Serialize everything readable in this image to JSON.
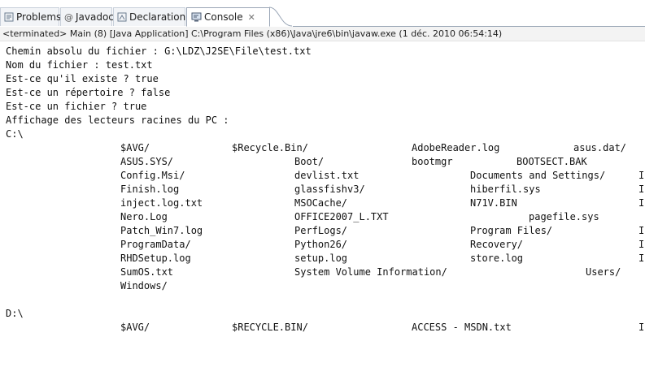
{
  "tabs": [
    {
      "label": "Problems",
      "icon": "problems-icon"
    },
    {
      "label": "Javadoc",
      "icon": "at-sign-icon"
    },
    {
      "label": "Declaration",
      "icon": "declaration-icon"
    },
    {
      "label": "Console",
      "icon": "console-icon",
      "active": true,
      "close": "✕"
    }
  ],
  "status_line": "<terminated> Main (8) [Java Application] C:\\Program Files (x86)\\Java\\jre6\\bin\\javaw.exe (1 déc. 2010 06:54:14)",
  "console": {
    "lines": [
      "Chemin absolu du fichier : G:\\LDZ\\J2SE\\File\\test.txt",
      "Nom du fichier : test.txt",
      "Est-ce qu'il existe ? true",
      "Est-ce un répertoire ? false",
      "Est-ce un fichier ? true",
      "Affichage des lecteurs racines du PC :",
      "C:\\"
    ],
    "c_entries": [
      [
        "$AVG/",
        "$Recycle.Bin/",
        "AdobeReader.log",
        "asus.dat/"
      ],
      [
        "ASUS.SYS/",
        "Boot/",
        "bootmgr",
        "BOOTSECT.BAK"
      ],
      [
        "Config.Msi/",
        "devlist.txt",
        "Documents and Settings/",
        "I"
      ],
      [
        "Finish.log",
        "glassfishv3/",
        "hiberfil.sys",
        "I"
      ],
      [
        "inject.log.txt",
        "MSOCache/",
        "N71V.BIN",
        "I"
      ],
      [
        "Nero.Log",
        "OFFICE2007_L.TXT",
        "pagefile.sys",
        ""
      ],
      [
        "Patch_Win7.log",
        "PerfLogs/",
        "Program Files/",
        "I"
      ],
      [
        "ProgramData/",
        "Python26/",
        "Recovery/",
        "I"
      ],
      [
        "RHDSetup.log",
        "setup.log",
        "store.log",
        "I"
      ],
      [
        "SumOS.txt",
        "System Volume Information/",
        "Users/",
        ""
      ],
      [
        "Windows/",
        "",
        "",
        ""
      ]
    ],
    "d_label": "D:\\",
    "d_entries": [
      [
        "$AVG/",
        "$RECYCLE.BIN/",
        "ACCESS - MSDN.txt",
        "I"
      ]
    ]
  },
  "colors": {
    "text": "#111111",
    "tab_border": "#9aa6b6",
    "status_bg": "#f3f3f3"
  }
}
